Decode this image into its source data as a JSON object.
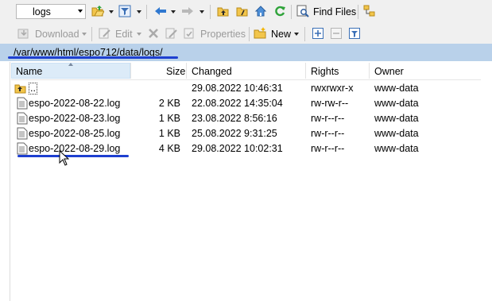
{
  "toolbar": {
    "folder_combo": "logs",
    "find_files_label": "Find Files"
  },
  "actions": {
    "download_label": "Download",
    "edit_label": "Edit",
    "properties_label": "Properties",
    "new_label": "New"
  },
  "path": "/var/www/html/espo712/data/logs/",
  "columns": {
    "name": "Name",
    "size": "Size",
    "changed": "Changed",
    "rights": "Rights",
    "owner": "Owner"
  },
  "files": [
    {
      "name": "..",
      "size": "",
      "changed": "29.08.2022 10:46:31",
      "rights": "rwxrwxr-x",
      "owner": "www-data"
    },
    {
      "name": "espo-2022-08-22.log",
      "size": "2 KB",
      "changed": "22.08.2022 14:35:04",
      "rights": "rw-rw-r--",
      "owner": "www-data"
    },
    {
      "name": "espo-2022-08-23.log",
      "size": "1 KB",
      "changed": "23.08.2022 8:56:16",
      "rights": "rw-r--r--",
      "owner": "www-data"
    },
    {
      "name": "espo-2022-08-25.log",
      "size": "1 KB",
      "changed": "25.08.2022 9:31:25",
      "rights": "rw-r--r--",
      "owner": "www-data"
    },
    {
      "name": "espo-2022-08-29.log",
      "size": "4 KB",
      "changed": "29.08.2022 10:02:31",
      "rights": "rw-r--r--",
      "owner": "www-data"
    }
  ],
  "colors": {
    "path_bar": "#b9d1ea",
    "annotation": "#1e3fd0",
    "header_selected": "#dcebf8"
  }
}
